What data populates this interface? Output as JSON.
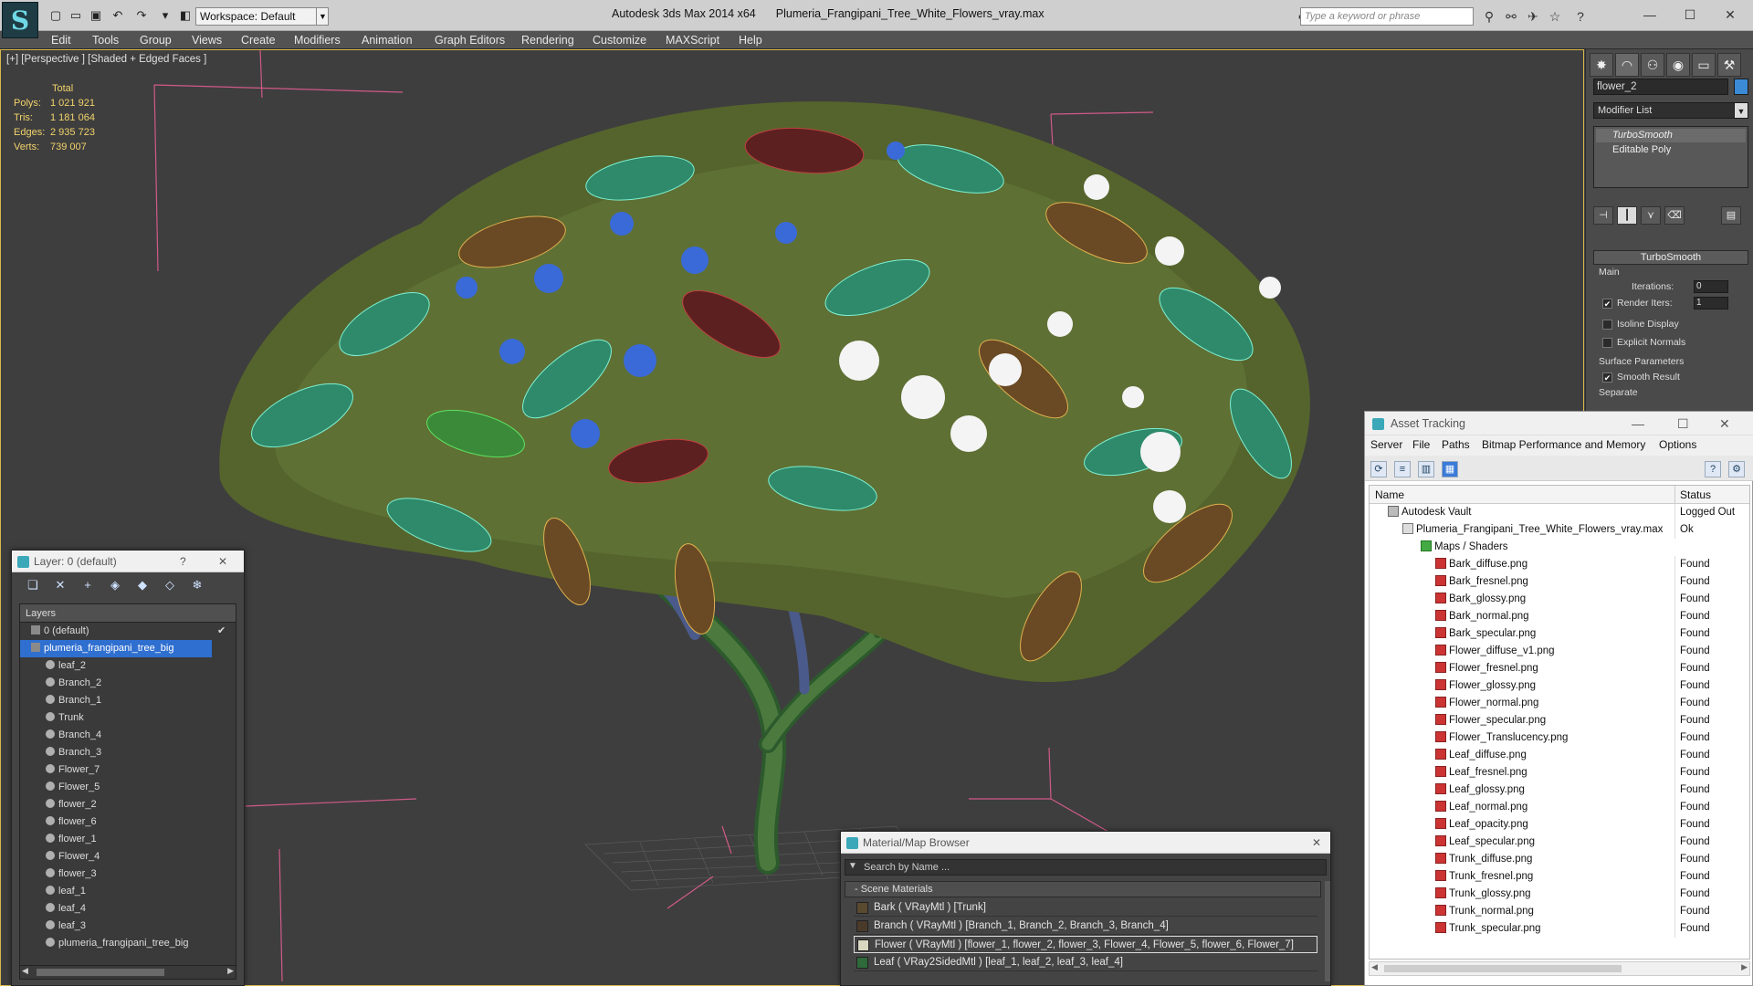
{
  "titlebar": {
    "workspace": "Workspace: Default",
    "app_title": "Autodesk 3ds Max  2014 x64",
    "file_title": "Plumeria_Frangipani_Tree_White_Flowers_vray.max",
    "search_placeholder": "Type a keyword or phrase"
  },
  "menu": [
    "Edit",
    "Tools",
    "Group",
    "Views",
    "Create",
    "Modifiers",
    "Animation",
    "Graph Editors",
    "Rendering",
    "Customize",
    "MAXScript",
    "Help"
  ],
  "viewport": {
    "label": "[+] [Perspective ] [Shaded + Edged Faces ]",
    "stats": {
      "header": "Total",
      "rows": [
        {
          "label": "Polys:",
          "value": "1 021 921"
        },
        {
          "label": "Tris:",
          "value": "1 181 064"
        },
        {
          "label": "Edges:",
          "value": "2 935 723"
        },
        {
          "label": "Verts:",
          "value": "739 007"
        }
      ]
    }
  },
  "command_panel": {
    "object_name": "flower_2",
    "object_color": "#3a8ad6",
    "modifier_list": "Modifier List",
    "stack": [
      "TurboSmooth",
      "Editable Poly"
    ],
    "rollout_title": "TurboSmooth",
    "main_label": "Main",
    "iterations_label": "Iterations:",
    "iterations_value": "0",
    "render_iters_label": "Render Iters:",
    "render_iters_value": "1",
    "isoline_label": "Isoline Display",
    "explicit_label": "Explicit Normals",
    "surface_label": "Surface Parameters",
    "smooth_label": "Smooth Result",
    "separate_label": "Separate"
  },
  "layer_manager": {
    "title": "Layer: 0 (default)",
    "help": "?",
    "header": "Layers",
    "rows": [
      {
        "name": "0 (default)",
        "level": 1,
        "check": "✔"
      },
      {
        "name": "plumeria_frangipani_tree_big",
        "level": 1,
        "selected": true
      },
      {
        "name": "leaf_2",
        "level": 2
      },
      {
        "name": "Branch_2",
        "level": 2
      },
      {
        "name": "Branch_1",
        "level": 2
      },
      {
        "name": "Trunk",
        "level": 2
      },
      {
        "name": "Branch_4",
        "level": 2
      },
      {
        "name": "Branch_3",
        "level": 2
      },
      {
        "name": "Flower_7",
        "level": 2
      },
      {
        "name": "Flower_5",
        "level": 2
      },
      {
        "name": "flower_2",
        "level": 2
      },
      {
        "name": "flower_6",
        "level": 2
      },
      {
        "name": "flower_1",
        "level": 2
      },
      {
        "name": "Flower_4",
        "level": 2
      },
      {
        "name": "flower_3",
        "level": 2
      },
      {
        "name": "leaf_1",
        "level": 2
      },
      {
        "name": "leaf_4",
        "level": 2
      },
      {
        "name": "leaf_3",
        "level": 2
      },
      {
        "name": "plumeria_frangipani_tree_big",
        "level": 2
      }
    ]
  },
  "material_browser": {
    "title": "Material/Map Browser",
    "search_placeholder": "Search by Name ...",
    "section": "- Scene Materials",
    "rows": [
      "Bark  ( VRayMtl )  [Trunk]",
      "Branch  ( VRayMtl )  [Branch_1, Branch_2, Branch_3, Branch_4]",
      "Flower  ( VRayMtl )  [flower_1, flower_2, flower_3, Flower_4, Flower_5, flower_6, Flower_7]",
      "Leaf  ( VRay2SidedMtl )  [leaf_1, leaf_2, leaf_3, leaf_4]"
    ]
  },
  "asset_tracking": {
    "title": "Asset Tracking",
    "menu": [
      "Server",
      "File",
      "Paths",
      "Bitmap Performance and Memory",
      "Options"
    ],
    "col_name": "Name",
    "col_status": "Status",
    "rows": [
      {
        "name": "Autodesk Vault",
        "status": "Logged Out",
        "level": 0,
        "kind": "vault"
      },
      {
        "name": "Plumeria_Frangipani_Tree_White_Flowers_vray.max",
        "status": "Ok",
        "level": 1,
        "kind": "max"
      },
      {
        "name": "Maps / Shaders",
        "status": "",
        "level": 2,
        "kind": "folder"
      },
      {
        "name": "Bark_diffuse.png",
        "status": "Found",
        "level": 3,
        "kind": "png"
      },
      {
        "name": "Bark_fresnel.png",
        "status": "Found",
        "level": 3,
        "kind": "png"
      },
      {
        "name": "Bark_glossy.png",
        "status": "Found",
        "level": 3,
        "kind": "png"
      },
      {
        "name": "Bark_normal.png",
        "status": "Found",
        "level": 3,
        "kind": "png"
      },
      {
        "name": "Bark_specular.png",
        "status": "Found",
        "level": 3,
        "kind": "png"
      },
      {
        "name": "Flower_diffuse_v1.png",
        "status": "Found",
        "level": 3,
        "kind": "png"
      },
      {
        "name": "Flower_fresnel.png",
        "status": "Found",
        "level": 3,
        "kind": "png"
      },
      {
        "name": "Flower_glossy.png",
        "status": "Found",
        "level": 3,
        "kind": "png"
      },
      {
        "name": "Flower_normal.png",
        "status": "Found",
        "level": 3,
        "kind": "png"
      },
      {
        "name": "Flower_specular.png",
        "status": "Found",
        "level": 3,
        "kind": "png"
      },
      {
        "name": "Flower_Translucency.png",
        "status": "Found",
        "level": 3,
        "kind": "png"
      },
      {
        "name": "Leaf_diffuse.png",
        "status": "Found",
        "level": 3,
        "kind": "png"
      },
      {
        "name": "Leaf_fresnel.png",
        "status": "Found",
        "level": 3,
        "kind": "png"
      },
      {
        "name": "Leaf_glossy.png",
        "status": "Found",
        "level": 3,
        "kind": "png"
      },
      {
        "name": "Leaf_normal.png",
        "status": "Found",
        "level": 3,
        "kind": "png"
      },
      {
        "name": "Leaf_opacity.png",
        "status": "Found",
        "level": 3,
        "kind": "png"
      },
      {
        "name": "Leaf_specular.png",
        "status": "Found",
        "level": 3,
        "kind": "png"
      },
      {
        "name": "Trunk_diffuse.png",
        "status": "Found",
        "level": 3,
        "kind": "png"
      },
      {
        "name": "Trunk_fresnel.png",
        "status": "Found",
        "level": 3,
        "kind": "png"
      },
      {
        "name": "Trunk_glossy.png",
        "status": "Found",
        "level": 3,
        "kind": "png"
      },
      {
        "name": "Trunk_normal.png",
        "status": "Found",
        "level": 3,
        "kind": "png"
      },
      {
        "name": "Trunk_specular.png",
        "status": "Found",
        "level": 3,
        "kind": "png"
      }
    ]
  },
  "colors": {
    "viewport_border": "#d8b84a",
    "stats_text": "#f2d36b",
    "selection": "#2f6fd0"
  }
}
